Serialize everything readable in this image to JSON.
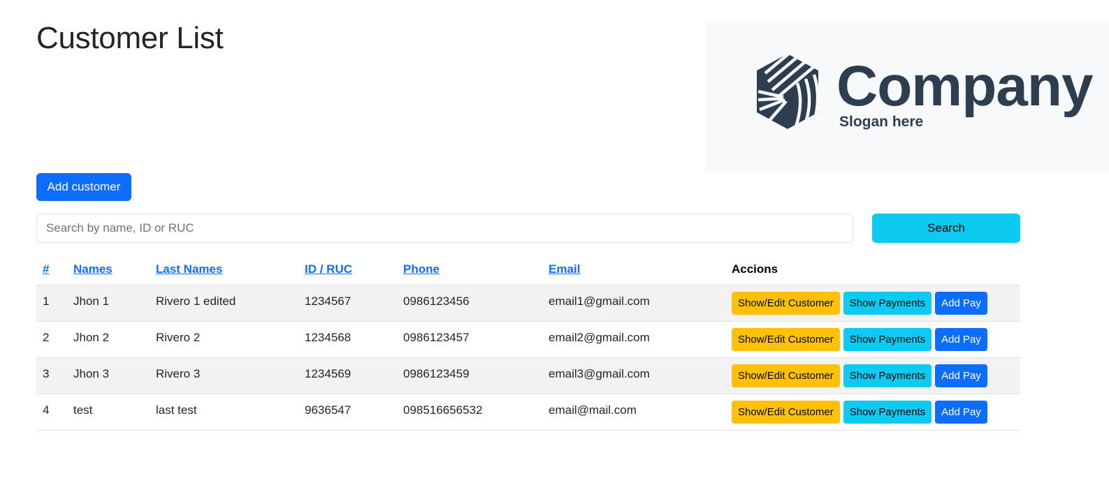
{
  "page": {
    "title": "Customer List"
  },
  "logo": {
    "name": "Company",
    "slogan": "Slogan here",
    "icon": "hexagon-stripes-logo-icon",
    "color": "#2d3e50"
  },
  "toolbar": {
    "add_label": "Add customer",
    "search_placeholder": "Search by name, ID or RUC",
    "search_value": "",
    "search_label": "Search"
  },
  "colors": {
    "primary": "#0d6efd",
    "info": "#0dcaf0",
    "warning": "#ffc107",
    "stripe": "#f2f2f2"
  },
  "table": {
    "headers": {
      "num": "#",
      "names": "Names",
      "last_names": "Last Names",
      "id": "ID / RUC",
      "phone": "Phone",
      "email": "Email",
      "actions": "Accions"
    },
    "action_labels": {
      "edit": "Show/Edit Customer",
      "payments": "Show Payments",
      "add_pay": "Add Pay"
    },
    "rows": [
      {
        "num": "1",
        "names": "Jhon 1",
        "last_names": "Rivero 1 edited",
        "id": "1234567",
        "phone": "0986123456",
        "email": "email1@gmail.com"
      },
      {
        "num": "2",
        "names": "Jhon 2",
        "last_names": "Rivero 2",
        "id": "1234568",
        "phone": "0986123457",
        "email": "email2@gmail.com"
      },
      {
        "num": "3",
        "names": "Jhon 3",
        "last_names": "Rivero 3",
        "id": "1234569",
        "phone": "0986123459",
        "email": "email3@gmail.com"
      },
      {
        "num": "4",
        "names": "test",
        "last_names": "last test",
        "id": "9636547",
        "phone": "098516656532",
        "email": "email@mail.com"
      }
    ]
  }
}
